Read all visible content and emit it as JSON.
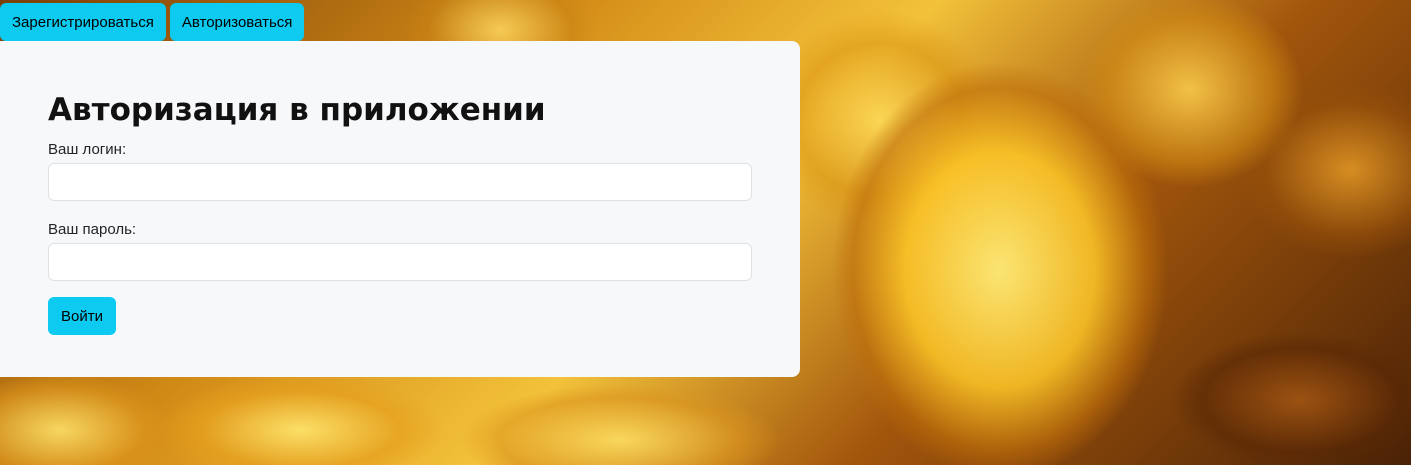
{
  "nav": {
    "register_label": "Зарегистрироваться",
    "login_label": "Авторизоваться"
  },
  "auth_form": {
    "title": "Авторизация в приложении",
    "login_label": "Ваш логин:",
    "login_value": "",
    "password_label": "Ваш пароль:",
    "password_value": "",
    "submit_label": "Войти"
  },
  "colors": {
    "accent": "#0dcaf0",
    "card_background": "#f7f8fa"
  },
  "background": {
    "image": "gold-coins"
  }
}
